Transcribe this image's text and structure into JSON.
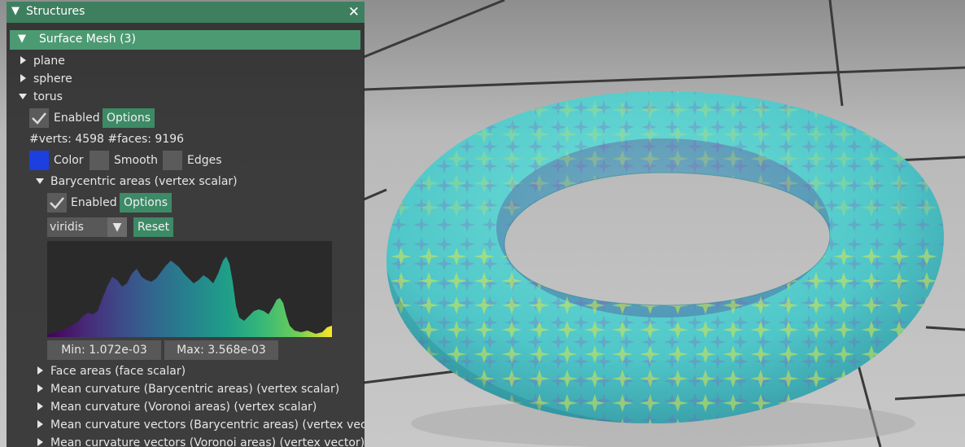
{
  "structures_panel": {
    "title": "Structures",
    "surface_mesh_header": "Surface Mesh (3)",
    "meshes": [
      "plane",
      "sphere",
      "torus"
    ],
    "torus": {
      "enabled_label": "Enabled",
      "enabled": true,
      "options_label": "Options",
      "stats": "#verts: 4598  #faces: 9196",
      "color_label": "Color",
      "color": "#1e3fe0",
      "smooth_label": "Smooth",
      "smooth": false,
      "edges_label": "Edges",
      "edges": false,
      "quantity": {
        "title": "Barycentric areas (vertex scalar)",
        "enabled_label": "Enabled",
        "enabled": true,
        "options_label": "Options",
        "colormap": "viridis",
        "reset_label": "Reset",
        "min_label": "Min: 1.072e-03",
        "max_label": "Max: 3.568e-03"
      },
      "other_quantities": [
        "Face areas (face scalar)",
        "Mean curvature (Barycentric areas) (vertex scalar)",
        "Mean curvature (Voronoi areas) (vertex scalar)",
        "Mean curvature vectors (Barycentric areas) (vertex vector)",
        "Mean curvature vectors (Voronoi areas) (vertex vector)"
      ]
    }
  },
  "colors": {
    "accent": "#4c9a72",
    "title_bar": "#3e7f60",
    "torus_base": "#45c0c8"
  },
  "icons": {
    "collapse": "triangle-down-icon",
    "expand": "triangle-right-icon",
    "close": "close-icon",
    "check": "check-icon",
    "dropdown": "chevron-down-icon"
  }
}
